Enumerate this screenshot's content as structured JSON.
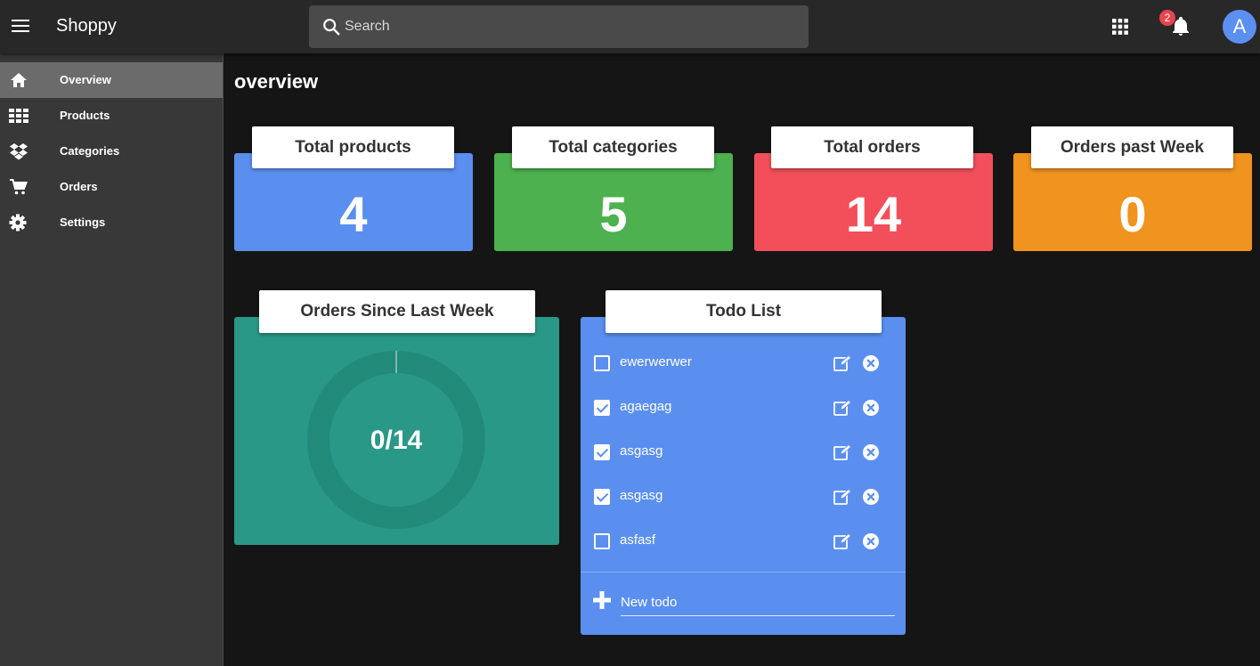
{
  "header": {
    "app_title": "Shoppy",
    "search_placeholder": "Search",
    "notification_count": "2",
    "avatar_initial": "A",
    "icons": [
      "menu-icon",
      "search-icon",
      "apps-icon",
      "bell-icon"
    ]
  },
  "sidebar": {
    "items": [
      {
        "label": "Overview",
        "icon": "home-icon",
        "active": true
      },
      {
        "label": "Products",
        "icon": "grid-icon",
        "active": false
      },
      {
        "label": "Categories",
        "icon": "dropbox-icon",
        "active": false
      },
      {
        "label": "Orders",
        "icon": "cart-icon",
        "active": false
      },
      {
        "label": "Settings",
        "icon": "gear-icon",
        "active": false
      }
    ]
  },
  "main": {
    "title": "overview",
    "stats": [
      {
        "label": "Total products",
        "value": "4",
        "color": "#5b8fef"
      },
      {
        "label": "Total categories",
        "value": "5",
        "color": "#4cb14e"
      },
      {
        "label": "Total orders",
        "value": "14",
        "color": "#f24f5b"
      },
      {
        "label": "Orders past Week",
        "value": "0",
        "color": "#f0931f"
      }
    ],
    "orders_chart": {
      "title": "Orders Since Last Week",
      "center_text": "0/14",
      "progress": 0
    },
    "todo": {
      "title": "Todo List",
      "items": [
        {
          "text": "ewerwerwer",
          "done": false
        },
        {
          "text": "agaegag",
          "done": true
        },
        {
          "text": "asgasg",
          "done": true
        },
        {
          "text": "asgasg",
          "done": true
        },
        {
          "text": "asfasf",
          "done": false
        }
      ],
      "new_placeholder": "New todo"
    }
  },
  "colors": {
    "topbar": "#282828",
    "sidebar": "#383838",
    "background": "#151515",
    "orders_panel": "#2a9886",
    "todo_panel": "#5b8fef",
    "badge": "#e8454f",
    "avatar": "#5b8ff0"
  }
}
